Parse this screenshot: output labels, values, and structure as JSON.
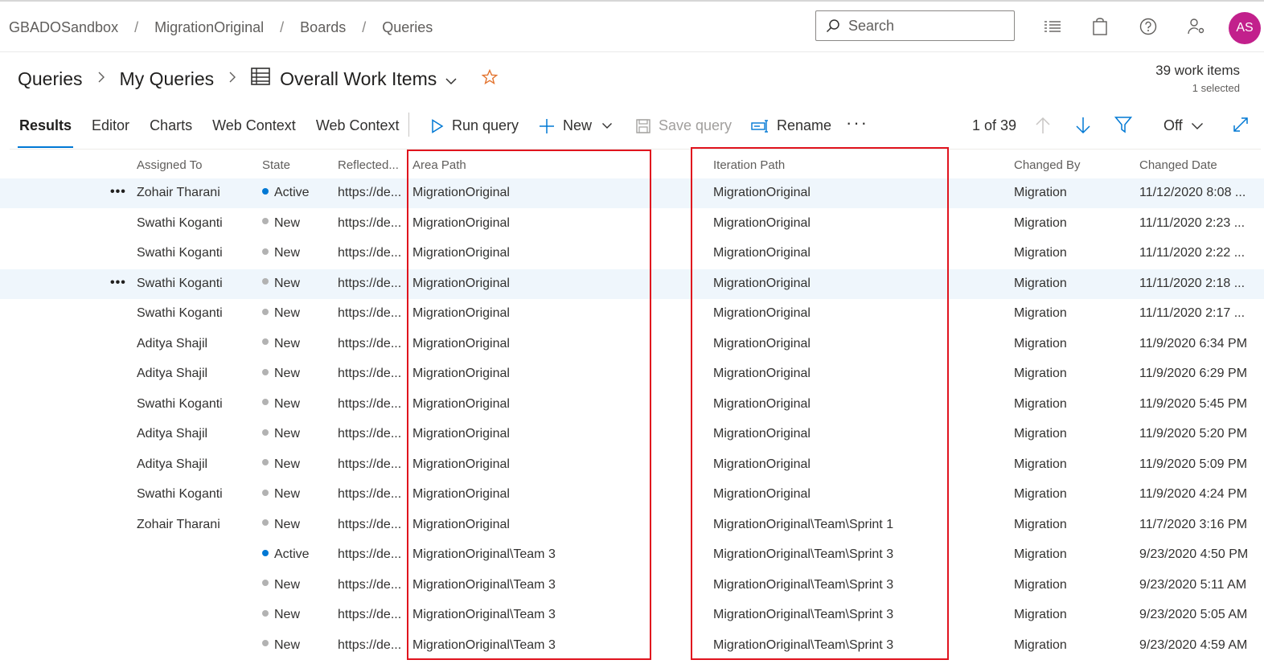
{
  "breadcrumbs": [
    "GBADOSandbox",
    "MigrationOriginal",
    "Boards",
    "Queries"
  ],
  "search": {
    "placeholder": "Search"
  },
  "user": {
    "initials": "AS",
    "color": "#c2208c"
  },
  "header_icons": [
    "list-icon",
    "shopping-bag-icon",
    "help-icon",
    "user-settings-icon"
  ],
  "title_path": {
    "root": "Queries",
    "folder": "My Queries",
    "query": "Overall Work Items"
  },
  "work_items": {
    "count": "39 work items",
    "selected": "1 selected"
  },
  "tabs": [
    "Results",
    "Editor",
    "Charts",
    "Web Context",
    "Web Context"
  ],
  "active_tab": "Results",
  "commands": {
    "run": "Run query",
    "new": "New",
    "save": "Save query",
    "rename": "Rename"
  },
  "pager": "1 of 39",
  "filter_toggle": "Off",
  "columns": {
    "assigned_to": "Assigned To",
    "state": "State",
    "reflected": "Reflected...",
    "area_path": "Area Path",
    "iteration_path": "Iteration Path",
    "changed_by": "Changed By",
    "changed_date": "Changed Date"
  },
  "status_colors": {
    "Active": "#0078d4",
    "New": "#b2b2b2"
  },
  "accent_color": "#0078d4",
  "highlight_color": "#e0141e",
  "rows": [
    {
      "assigned": "Zohair Tharani",
      "state": "Active",
      "reflected": "https://de...",
      "area": "MigrationOriginal",
      "iteration": "MigrationOriginal",
      "changed_by": "Migration",
      "date": "11/12/2020 8:08 ...",
      "selected": true
    },
    {
      "assigned": "Swathi Koganti",
      "state": "New",
      "reflected": "https://de...",
      "area": "MigrationOriginal",
      "iteration": "MigrationOriginal",
      "changed_by": "Migration",
      "date": "11/11/2020 2:23 ..."
    },
    {
      "assigned": "Swathi Koganti",
      "state": "New",
      "reflected": "https://de...",
      "area": "MigrationOriginal",
      "iteration": "MigrationOriginal",
      "changed_by": "Migration",
      "date": "11/11/2020 2:22 ..."
    },
    {
      "assigned": "Swathi Koganti",
      "state": "New",
      "reflected": "https://de...",
      "area": "MigrationOriginal",
      "iteration": "MigrationOriginal",
      "changed_by": "Migration",
      "date": "11/11/2020 2:18 ...",
      "selected": true
    },
    {
      "assigned": "Swathi Koganti",
      "state": "New",
      "reflected": "https://de...",
      "area": "MigrationOriginal",
      "iteration": "MigrationOriginal",
      "changed_by": "Migration",
      "date": "11/11/2020 2:17 ..."
    },
    {
      "assigned": "Aditya Shajil",
      "state": "New",
      "reflected": "https://de...",
      "area": "MigrationOriginal",
      "iteration": "MigrationOriginal",
      "changed_by": "Migration",
      "date": "11/9/2020 6:34 PM"
    },
    {
      "assigned": "Aditya Shajil",
      "state": "New",
      "reflected": "https://de...",
      "area": "MigrationOriginal",
      "iteration": "MigrationOriginal",
      "changed_by": "Migration",
      "date": "11/9/2020 6:29 PM"
    },
    {
      "assigned": "Swathi Koganti",
      "state": "New",
      "reflected": "https://de...",
      "area": "MigrationOriginal",
      "iteration": "MigrationOriginal",
      "changed_by": "Migration",
      "date": "11/9/2020 5:45 PM"
    },
    {
      "assigned": "Aditya Shajil",
      "state": "New",
      "reflected": "https://de...",
      "area": "MigrationOriginal",
      "iteration": "MigrationOriginal",
      "changed_by": "Migration",
      "date": "11/9/2020 5:20 PM"
    },
    {
      "assigned": "Aditya Shajil",
      "state": "New",
      "reflected": "https://de...",
      "area": "MigrationOriginal",
      "iteration": "MigrationOriginal",
      "changed_by": "Migration",
      "date": "11/9/2020 5:09 PM"
    },
    {
      "assigned": "Swathi Koganti",
      "state": "New",
      "reflected": "https://de...",
      "area": "MigrationOriginal",
      "iteration": "MigrationOriginal",
      "changed_by": "Migration",
      "date": "11/9/2020 4:24 PM"
    },
    {
      "assigned": "Zohair Tharani",
      "state": "New",
      "reflected": "https://de...",
      "area": "MigrationOriginal",
      "iteration": "MigrationOriginal\\Team\\Sprint 1",
      "changed_by": "Migration",
      "date": "11/7/2020 3:16 PM"
    },
    {
      "assigned": "",
      "state": "Active",
      "reflected": "https://de...",
      "area": "MigrationOriginal\\Team 3",
      "iteration": "MigrationOriginal\\Team\\Sprint 3",
      "changed_by": "Migration",
      "date": "9/23/2020 4:50 PM"
    },
    {
      "assigned": "",
      "state": "New",
      "reflected": "https://de...",
      "area": "MigrationOriginal\\Team 3",
      "iteration": "MigrationOriginal\\Team\\Sprint 3",
      "changed_by": "Migration",
      "date": "9/23/2020 5:11 AM"
    },
    {
      "assigned": "",
      "state": "New",
      "reflected": "https://de...",
      "area": "MigrationOriginal\\Team 3",
      "iteration": "MigrationOriginal\\Team\\Sprint 3",
      "changed_by": "Migration",
      "date": "9/23/2020 5:05 AM"
    },
    {
      "assigned": "",
      "state": "New",
      "reflected": "https://de...",
      "area": "MigrationOriginal\\Team 3",
      "iteration": "MigrationOriginal\\Team\\Sprint 3",
      "changed_by": "Migration",
      "date": "9/23/2020 4:59 AM"
    }
  ]
}
